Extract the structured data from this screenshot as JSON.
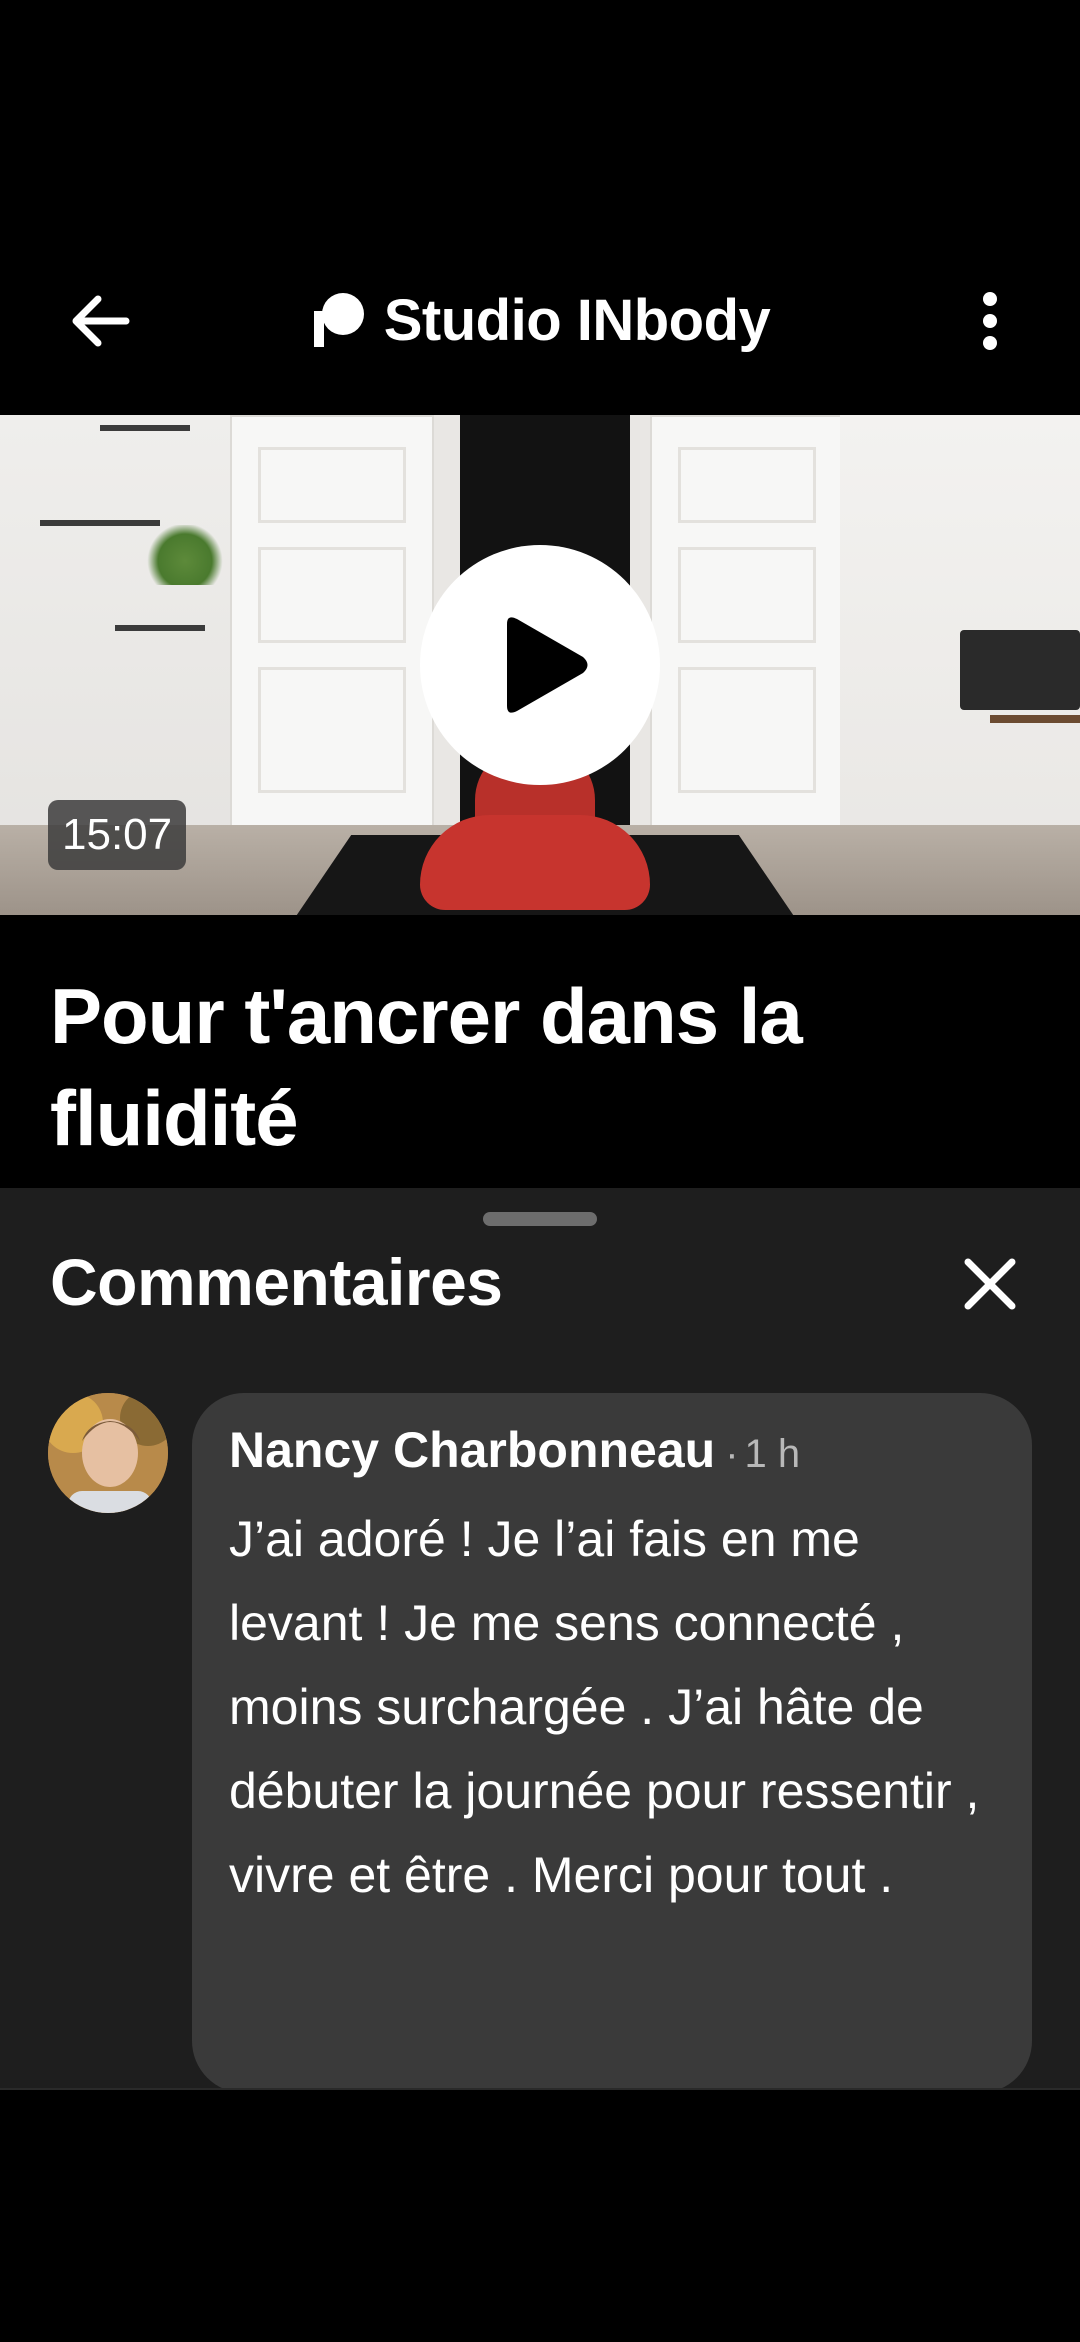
{
  "header": {
    "brand_name": "Studio INbody",
    "back_icon": "arrow-left-icon",
    "menu_icon": "more-vertical-icon",
    "logo_icon": "patreon-logo-icon"
  },
  "video": {
    "duration": "15:07",
    "play_icon": "play-icon"
  },
  "post": {
    "title": "Pour t'ancrer dans la fluidité"
  },
  "comments": {
    "title": "Commentaires",
    "close_icon": "close-icon",
    "items": [
      {
        "author": "Nancy Charbonneau",
        "separator": "·",
        "time": "1 h",
        "text": "J’ai adoré ! Je l’ai fais en me levant ! Je me sens connecté , moins surchargée . J’ai hâte de débuter la journée pour ressentir , vivre et être . Merci pour tout ."
      }
    ]
  },
  "colors": {
    "background": "#000000",
    "sheet": "#1e1e1e",
    "bubble": "#3a3a3a",
    "text": "#ffffff",
    "muted": "#b8b8b8"
  }
}
